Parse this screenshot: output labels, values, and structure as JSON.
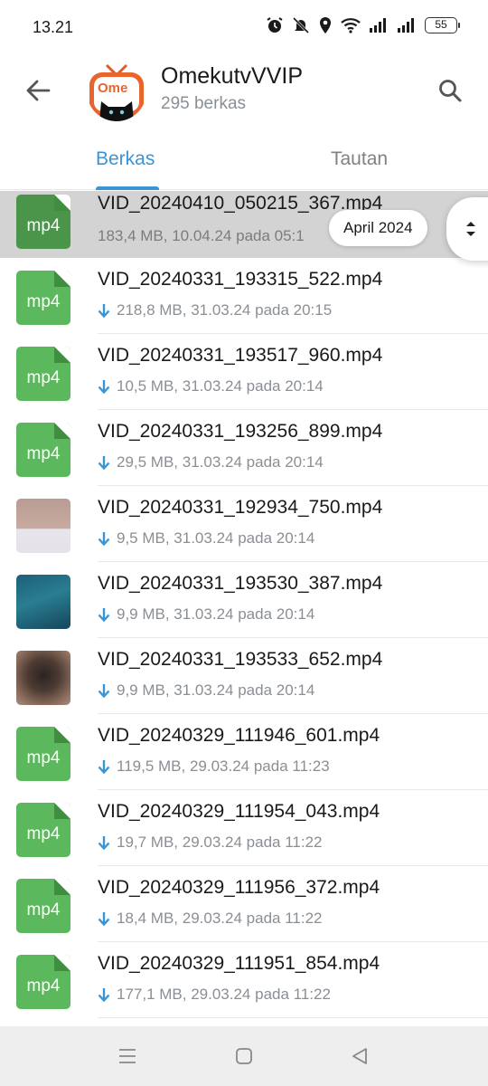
{
  "status_bar": {
    "time": "13.21",
    "battery": "55"
  },
  "header": {
    "title": "OmekutvVVIP",
    "subtitle": "295 berkas",
    "avatar_text": "Ome"
  },
  "tabs": [
    {
      "label": "Berkas",
      "active": true
    },
    {
      "label": "Tautan",
      "active": false
    }
  ],
  "date_pill": "April 2024",
  "files": [
    {
      "name": "VID_20240410_050215_367.mp4",
      "meta": "183,4 MB, 10.04.24 pada 05:1",
      "thumb": "mp4",
      "thumb_label": "mp4",
      "downloaded_arrow": false
    },
    {
      "name": "VID_20240331_193315_522.mp4",
      "meta": "218,8 MB, 31.03.24 pada 20:15",
      "thumb": "mp4",
      "thumb_label": "mp4",
      "downloaded_arrow": true
    },
    {
      "name": "VID_20240331_193517_960.mp4",
      "meta": "10,5 MB, 31.03.24 pada 20:14",
      "thumb": "mp4",
      "thumb_label": "mp4",
      "downloaded_arrow": true
    },
    {
      "name": "VID_20240331_193256_899.mp4",
      "meta": "29,5 MB, 31.03.24 pada 20:14",
      "thumb": "mp4",
      "thumb_label": "mp4",
      "downloaded_arrow": true
    },
    {
      "name": "VID_20240331_192934_750.mp4",
      "meta": "9,5 MB, 31.03.24 pada 20:14",
      "thumb": "photo-1",
      "downloaded_arrow": true
    },
    {
      "name": "VID_20240331_193530_387.mp4",
      "meta": "9,9 MB, 31.03.24 pada 20:14",
      "thumb": "photo-2",
      "downloaded_arrow": true
    },
    {
      "name": "VID_20240331_193533_652.mp4",
      "meta": "9,9 MB, 31.03.24 pada 20:14",
      "thumb": "photo-3",
      "downloaded_arrow": true
    },
    {
      "name": "VID_20240329_111946_601.mp4",
      "meta": "119,5 MB, 29.03.24 pada 11:23",
      "thumb": "mp4",
      "thumb_label": "mp4",
      "downloaded_arrow": true
    },
    {
      "name": "VID_20240329_111954_043.mp4",
      "meta": "19,7 MB, 29.03.24 pada 11:22",
      "thumb": "mp4",
      "thumb_label": "mp4",
      "downloaded_arrow": true
    },
    {
      "name": "VID_20240329_111956_372.mp4",
      "meta": "18,4 MB, 29.03.24 pada 11:22",
      "thumb": "mp4",
      "thumb_label": "mp4",
      "downloaded_arrow": true
    },
    {
      "name": "VID_20240329_111951_854.mp4",
      "meta": "177,1 MB, 29.03.24 pada 11:22",
      "thumb": "mp4",
      "thumb_label": "mp4",
      "downloaded_arrow": true
    }
  ],
  "colors": {
    "accent": "#3a95d5",
    "file_green": "#5cb85c",
    "meta_gray": "#8a8f95",
    "highlight_row": "#d3d3d3"
  },
  "icons": {
    "back": "arrow-left-icon",
    "search": "search-icon",
    "download": "arrow-down-icon",
    "scroll": "chevron-up-down-icon",
    "nav": [
      "menu-icon",
      "home-square-icon",
      "back-triangle-icon"
    ]
  }
}
